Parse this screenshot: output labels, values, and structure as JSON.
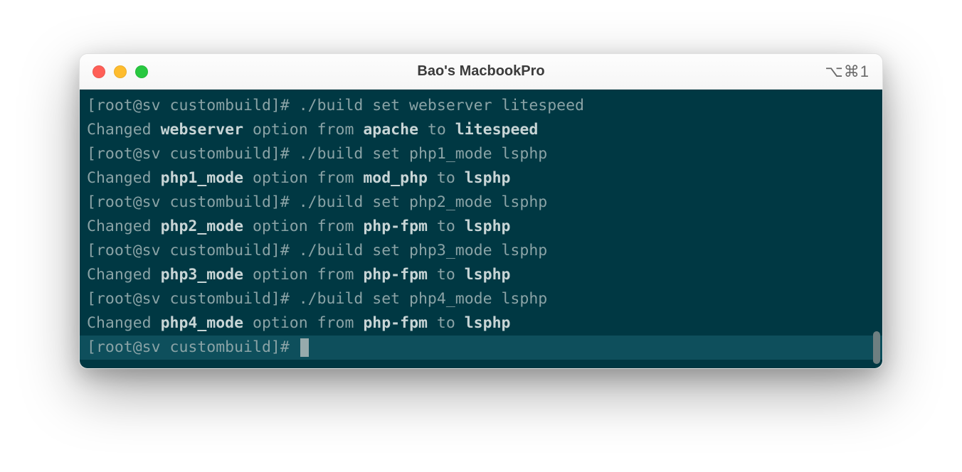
{
  "window": {
    "title": "Bao's MacbookPro",
    "indicator": "⌥⌘1"
  },
  "terminal": {
    "lines": [
      {
        "prompt": "[root@sv custombuild]# ",
        "cmd": "./build set webserver litespeed"
      },
      {
        "text_pre": "Changed ",
        "b1": "webserver",
        "mid1": " option from ",
        "b2": "apache",
        "mid2": " to ",
        "b3": "litespeed"
      },
      {
        "prompt": "[root@sv custombuild]# ",
        "cmd": "./build set php1_mode lsphp"
      },
      {
        "text_pre": "Changed ",
        "b1": "php1_mode",
        "mid1": " option from ",
        "b2": "mod_php",
        "mid2": " to ",
        "b3": "lsphp"
      },
      {
        "prompt": "[root@sv custombuild]# ",
        "cmd": "./build set php2_mode lsphp"
      },
      {
        "text_pre": "Changed ",
        "b1": "php2_mode",
        "mid1": " option from ",
        "b2": "php-fpm",
        "mid2": " to ",
        "b3": "lsphp"
      },
      {
        "prompt": "[root@sv custombuild]# ",
        "cmd": "./build set php3_mode lsphp"
      },
      {
        "text_pre": "Changed ",
        "b1": "php3_mode",
        "mid1": " option from ",
        "b2": "php-fpm",
        "mid2": " to ",
        "b3": "lsphp"
      },
      {
        "prompt": "[root@sv custombuild]# ",
        "cmd": "./build set php4_mode lsphp"
      },
      {
        "text_pre": "Changed ",
        "b1": "php4_mode",
        "mid1": " option from ",
        "b2": "php-fpm",
        "mid2": " to ",
        "b3": "lsphp"
      }
    ],
    "active_prompt": "[root@sv custombuild]# "
  },
  "colors": {
    "terminal_bg": "#003843",
    "terminal_text": "#8aa3a6",
    "terminal_bold": "#c8d5d6",
    "active_line_bg": "#0e4f5c"
  }
}
